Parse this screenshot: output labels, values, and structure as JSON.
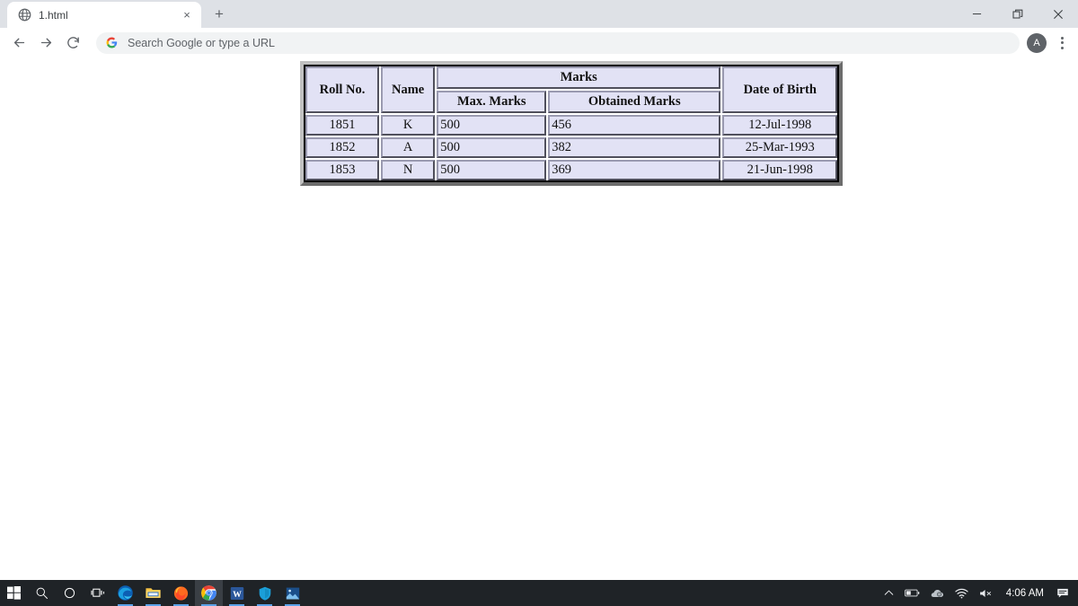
{
  "browser": {
    "tab": {
      "title": "1.html",
      "favicon": "globe-icon",
      "close_label": "×"
    },
    "new_tab_label": "+",
    "window_controls": {
      "minimize": "minimize-icon",
      "restore": "restore-icon",
      "close": "close-icon"
    },
    "toolbar": {
      "back": "back-arrow-icon",
      "forward": "forward-arrow-icon",
      "reload": "reload-icon",
      "omnibox_icon": "google-g-icon",
      "omnibox_placeholder": "Search Google or type a URL",
      "omnibox_value": "",
      "avatar_initial": "A",
      "menu": "three-dot-menu-icon"
    }
  },
  "table": {
    "headers": {
      "roll_no": "Roll No.",
      "name": "Name",
      "marks_group": "Marks",
      "max_marks": "Max. Marks",
      "obtained_marks": "Obtained Marks",
      "date_of_birth": "Date of Birth"
    },
    "rows": [
      {
        "roll_no": "1851",
        "name": "K",
        "max_marks": "500",
        "obtained_marks": "456",
        "dob": "12-Jul-1998"
      },
      {
        "roll_no": "1852",
        "name": "A",
        "max_marks": "500",
        "obtained_marks": "382",
        "dob": "25-Mar-1993"
      },
      {
        "roll_no": "1853",
        "name": "N",
        "max_marks": "500",
        "obtained_marks": "369",
        "dob": "21-Jun-1998"
      }
    ],
    "cell_background": "#e2e2f5",
    "border_color": "#000000"
  },
  "taskbar": {
    "items": [
      {
        "name": "start-button",
        "icon": "windows-logo-icon"
      },
      {
        "name": "search-button",
        "icon": "search-icon"
      },
      {
        "name": "cortana-button",
        "icon": "circle-icon"
      },
      {
        "name": "task-view-button",
        "icon": "task-view-icon"
      },
      {
        "name": "edge-button",
        "icon": "edge-icon"
      },
      {
        "name": "file-explorer-button",
        "icon": "folder-icon"
      },
      {
        "name": "firefox-button",
        "icon": "firefox-icon"
      },
      {
        "name": "chrome-button",
        "icon": "chrome-icon"
      },
      {
        "name": "word-button",
        "icon": "word-icon"
      },
      {
        "name": "security-button",
        "icon": "shield-icon"
      },
      {
        "name": "photos-button",
        "icon": "photos-icon"
      }
    ],
    "tray": {
      "show_hidden": "chevron-up-icon",
      "battery": "battery-icon",
      "onedrive": "cloud-icon",
      "network": "wifi-icon",
      "volume": "speaker-muted-icon",
      "clock": "4:06 AM",
      "notifications": "notification-icon"
    }
  }
}
